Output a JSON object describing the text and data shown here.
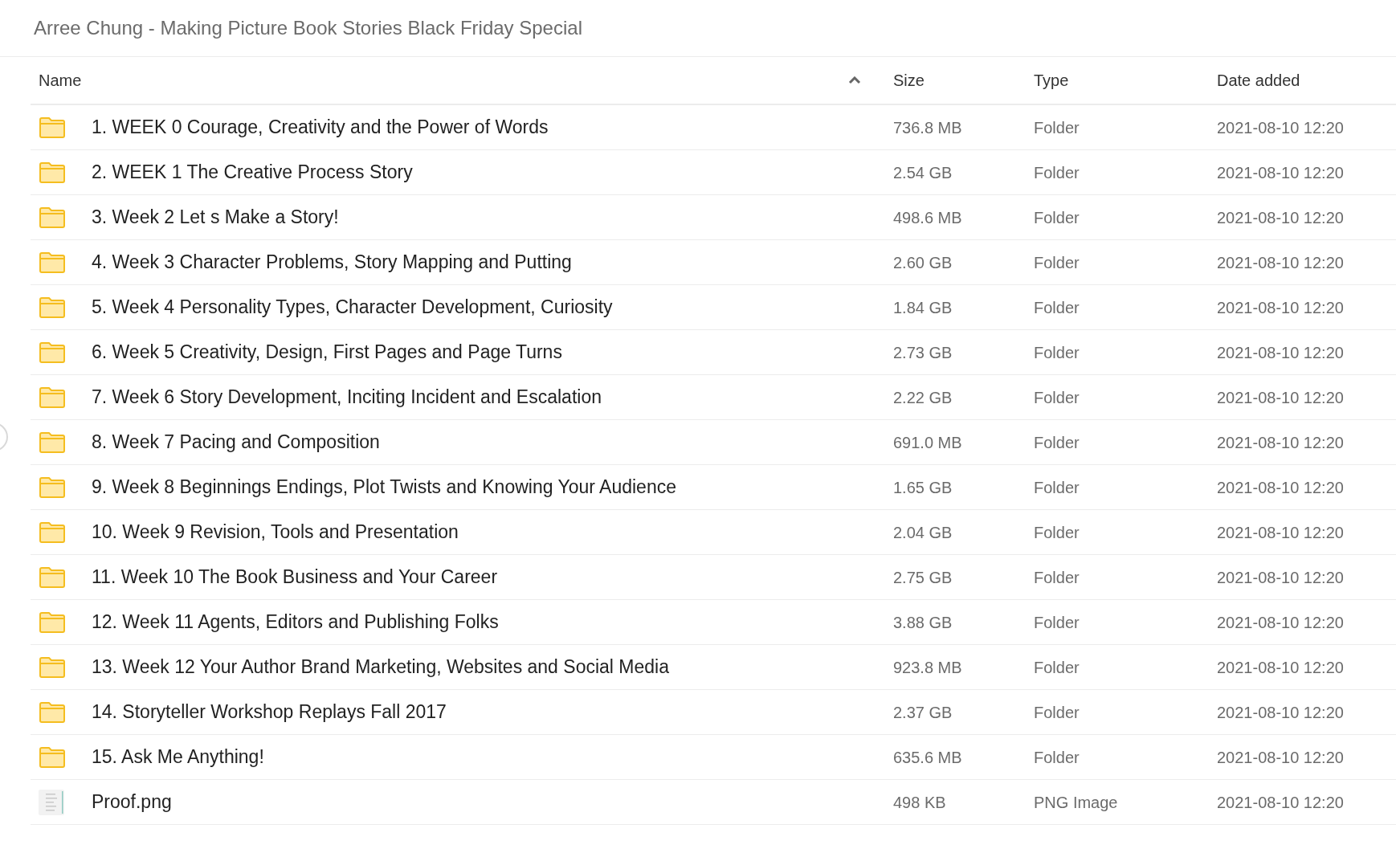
{
  "title": "Arree Chung - Making Picture Book Stories Black Friday Special",
  "table": {
    "columns": [
      {
        "label": "Name",
        "sorted": true
      },
      {
        "label": "Size",
        "sorted": false
      },
      {
        "label": "Type",
        "sorted": false
      },
      {
        "label": "Date added",
        "sorted": false
      }
    ],
    "rows": [
      {
        "kind": "folder",
        "name": "1. WEEK 0 Courage, Creativity and the Power of Words",
        "size": "736.8 MB",
        "type": "Folder",
        "date": "2021-08-10 12:20"
      },
      {
        "kind": "folder",
        "name": "2. WEEK 1 The Creative Process Story",
        "size": "2.54 GB",
        "type": "Folder",
        "date": "2021-08-10 12:20"
      },
      {
        "kind": "folder",
        "name": "3. Week 2 Let s Make a Story!",
        "size": "498.6 MB",
        "type": "Folder",
        "date": "2021-08-10 12:20"
      },
      {
        "kind": "folder",
        "name": "4. Week 3 Character Problems, Story Mapping and Putting",
        "size": "2.60 GB",
        "type": "Folder",
        "date": "2021-08-10 12:20"
      },
      {
        "kind": "folder",
        "name": "5. Week 4 Personality Types, Character Development, Curiosity",
        "size": "1.84 GB",
        "type": "Folder",
        "date": "2021-08-10 12:20"
      },
      {
        "kind": "folder",
        "name": "6. Week 5 Creativity, Design, First Pages and Page Turns",
        "size": "2.73 GB",
        "type": "Folder",
        "date": "2021-08-10 12:20"
      },
      {
        "kind": "folder",
        "name": "7. Week 6 Story Development, Inciting Incident and Escalation",
        "size": "2.22 GB",
        "type": "Folder",
        "date": "2021-08-10 12:20"
      },
      {
        "kind": "folder",
        "name": "8. Week 7 Pacing and Composition",
        "size": "691.0 MB",
        "type": "Folder",
        "date": "2021-08-10 12:20"
      },
      {
        "kind": "folder",
        "name": "9. Week 8 Beginnings Endings, Plot Twists and Knowing Your Audience",
        "size": "1.65 GB",
        "type": "Folder",
        "date": "2021-08-10 12:20"
      },
      {
        "kind": "folder",
        "name": "10. Week 9 Revision, Tools and Presentation",
        "size": "2.04 GB",
        "type": "Folder",
        "date": "2021-08-10 12:20"
      },
      {
        "kind": "folder",
        "name": "11. Week 10 The Book Business and Your Career",
        "size": "2.75 GB",
        "type": "Folder",
        "date": "2021-08-10 12:20"
      },
      {
        "kind": "folder",
        "name": "12. Week 11 Agents, Editors and Publishing Folks",
        "size": "3.88 GB",
        "type": "Folder",
        "date": "2021-08-10 12:20"
      },
      {
        "kind": "folder",
        "name": "13. Week 12 Your Author Brand Marketing, Websites and Social Media",
        "size": "923.8 MB",
        "type": "Folder",
        "date": "2021-08-10 12:20"
      },
      {
        "kind": "folder",
        "name": "14. Storyteller Workshop Replays Fall 2017",
        "size": "2.37 GB",
        "type": "Folder",
        "date": "2021-08-10 12:20"
      },
      {
        "kind": "folder",
        "name": "15. Ask Me Anything!",
        "size": "635.6 MB",
        "type": "Folder",
        "date": "2021-08-10 12:20"
      },
      {
        "kind": "image",
        "name": "Proof.png",
        "size": "498 KB",
        "type": "PNG Image",
        "date": "2021-08-10 12:20"
      }
    ]
  }
}
